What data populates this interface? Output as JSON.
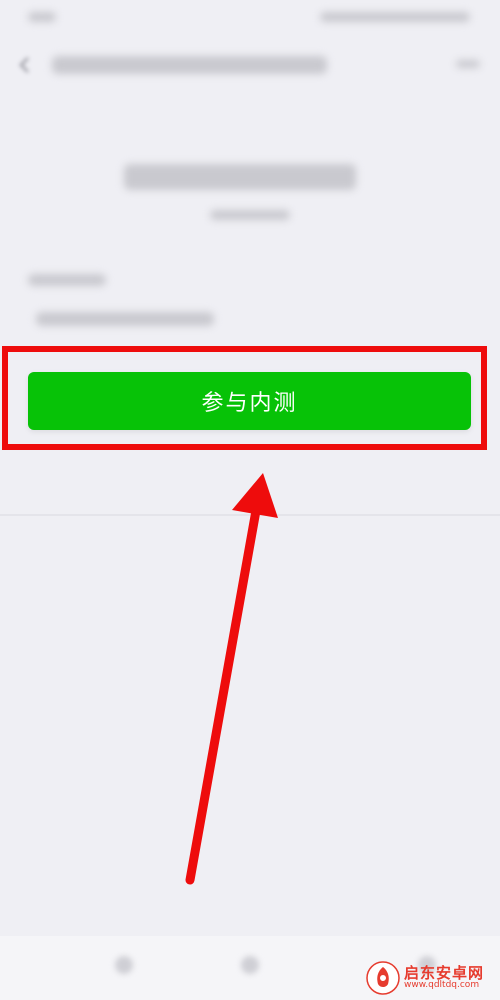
{
  "main": {
    "join_button_label": "参与内测"
  },
  "watermark": {
    "title": "启东安卓网",
    "url": "www.qdltdq.com"
  },
  "colors": {
    "button_green": "#07c207",
    "highlight_red": "#ee0c0c",
    "page_background": "#efeff4",
    "watermark_red": "#e63b2e"
  },
  "icons": {
    "back": "back-arrow-icon",
    "annotation": "red-arrow-annotation-icon",
    "logo": "watermark-logo-icon"
  }
}
